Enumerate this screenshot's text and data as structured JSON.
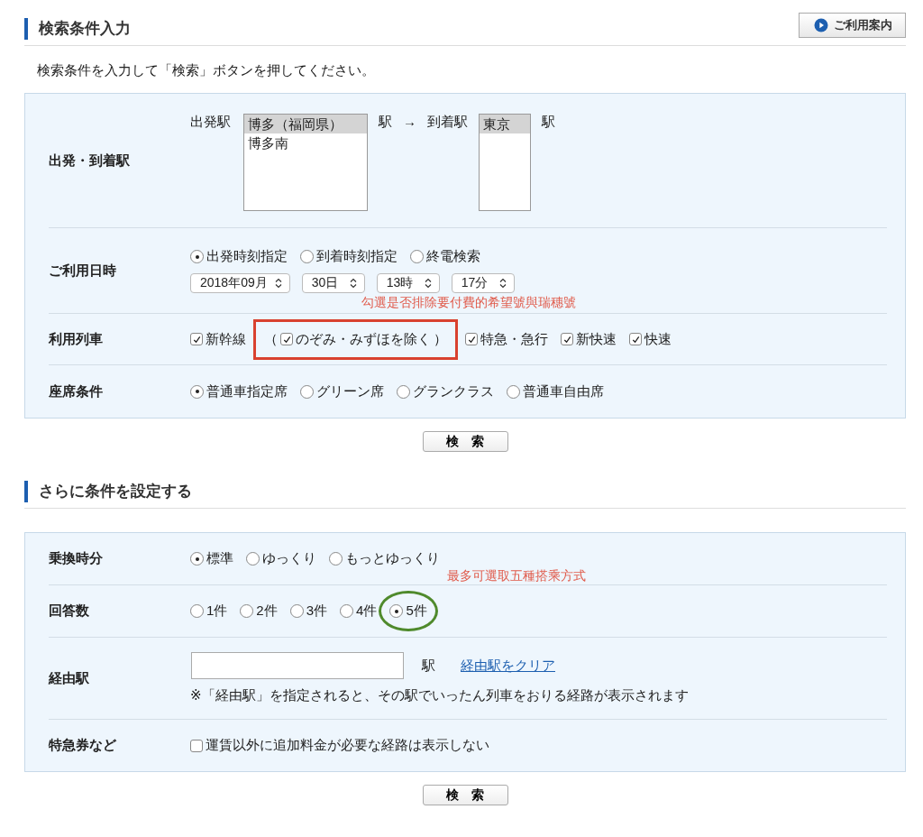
{
  "section1": {
    "title": "検索条件入力",
    "help_button": "ご利用案内"
  },
  "instruction": "検索条件を入力して「検索」ボタンを押してください。",
  "basic_form": {
    "stations": {
      "label": "出発・到着駅",
      "from_label": "出発駅",
      "from_options": [
        {
          "text": "博多（福岡県）",
          "selected": true
        },
        {
          "text": "博多南",
          "selected": false
        }
      ],
      "from_suffix": "駅",
      "arrow": "→",
      "to_label": "到着駅",
      "to_options": [
        {
          "text": "東京",
          "selected": true
        }
      ],
      "to_suffix": "駅"
    },
    "datetime": {
      "label": "ご利用日時",
      "modes": [
        {
          "text": "出発時刻指定",
          "selected": true
        },
        {
          "text": "到着時刻指定",
          "selected": false
        },
        {
          "text": "終電検索",
          "selected": false
        }
      ],
      "selects": [
        "2018年09月",
        "30日",
        "13時",
        "17分"
      ]
    },
    "trains": {
      "label": "利用列車",
      "note": "勾選是否排除要付費的希望號與瑞穗號",
      "options": [
        {
          "kind": "plain",
          "text": "新幹線",
          "checked": true,
          "boxed": false
        },
        {
          "kind": "parenthesized",
          "open": "（",
          "text": "のぞみ・みずほを除く",
          "close": "）",
          "checked": true,
          "boxed": true
        },
        {
          "kind": "plain",
          "text": "特急・急行",
          "checked": true,
          "boxed": false
        },
        {
          "kind": "plain",
          "text": "新快速",
          "checked": true,
          "boxed": false
        },
        {
          "kind": "plain",
          "text": "快速",
          "checked": true,
          "boxed": false
        }
      ]
    },
    "seats": {
      "label": "座席条件",
      "options": [
        {
          "text": "普通車指定席",
          "selected": true
        },
        {
          "text": "グリーン席",
          "selected": false
        },
        {
          "text": "グランクラス",
          "selected": false
        },
        {
          "text": "普通車自由席",
          "selected": false
        }
      ]
    }
  },
  "search_button_1": "検　索",
  "section2": {
    "title": "さらに条件を設定する"
  },
  "more_form": {
    "transfer": {
      "label": "乗換時分",
      "options": [
        {
          "text": "標準",
          "selected": true
        },
        {
          "text": "ゆっくり",
          "selected": false
        },
        {
          "text": "もっとゆっくり",
          "selected": false
        }
      ]
    },
    "answers": {
      "label": "回答数",
      "note": "最多可選取五種搭乘方式",
      "options": [
        {
          "text": "1件",
          "selected": false,
          "circled": false
        },
        {
          "text": "2件",
          "selected": false,
          "circled": false
        },
        {
          "text": "3件",
          "selected": false,
          "circled": false
        },
        {
          "text": "4件",
          "selected": false,
          "circled": false
        },
        {
          "text": "5件",
          "selected": true,
          "circled": true
        }
      ]
    },
    "via": {
      "label": "経由駅",
      "suffix": "駅",
      "clear_link": "経由駅をクリア",
      "hint": "※「経由駅」を指定されると、その駅でいったん列車をおりる経路が表示されます"
    },
    "express": {
      "label": "特急券など",
      "text": "運賃以外に追加料金が必要な経路は表示しない",
      "checked": false
    }
  },
  "search_button_2": "検　索"
}
